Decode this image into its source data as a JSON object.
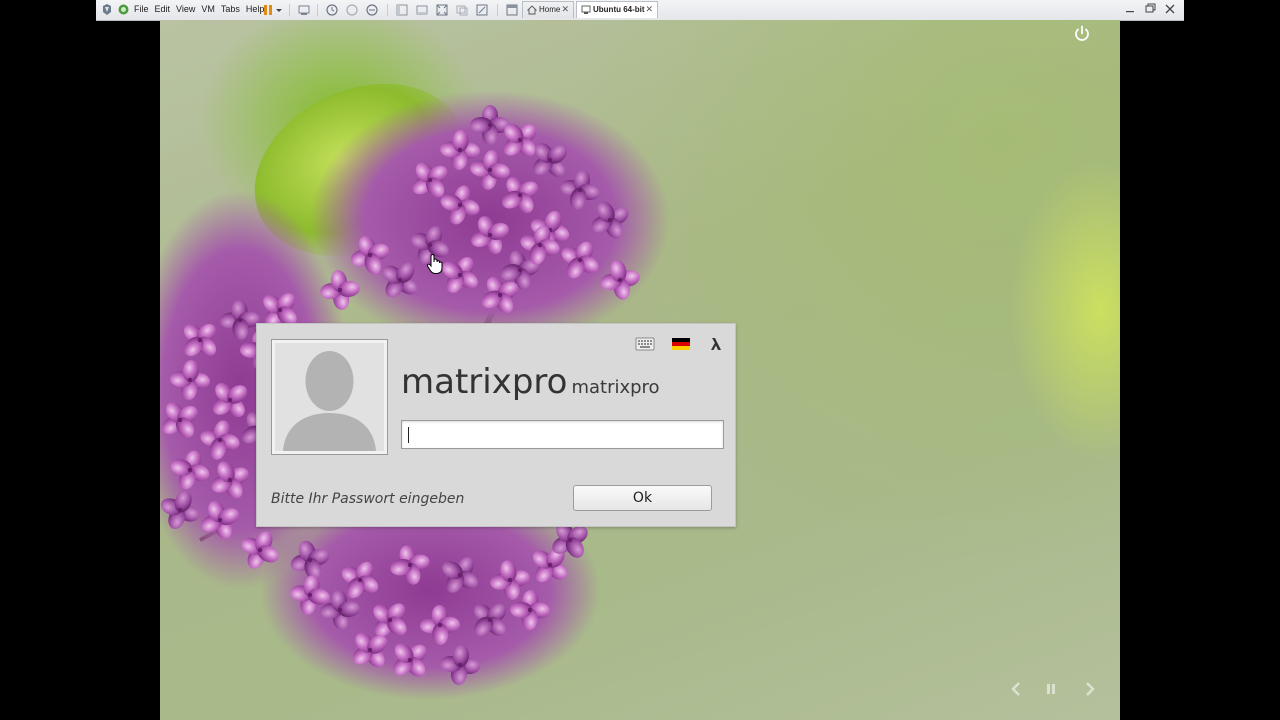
{
  "vmware": {
    "menu": [
      "File",
      "Edit",
      "View",
      "VM",
      "Tabs",
      "Help"
    ],
    "tabs": [
      {
        "label": "Home",
        "active": false
      },
      {
        "label": "Ubuntu 64-bit",
        "active": true
      }
    ],
    "tab_close_glyph": "✕",
    "toolbar_icons": [
      "pause-icon",
      "dropdown-arrow-icon",
      "send-ctrl-alt-del-icon",
      "snapshot-take-icon",
      "snapshot-revert-icon",
      "snapshot-manager-icon",
      "console-view-icon",
      "full-screen-icon",
      "fit-guest-icon",
      "unity-icon",
      "stretch-icon",
      "library-icon"
    ]
  },
  "login": {
    "username_large": "matrixpro",
    "username_small": "matrixpro",
    "password_value": "",
    "prompt": "Bitte Ihr Passwort eingeben",
    "ok_label": "Ok",
    "icons": [
      "keyboard-icon",
      "german-flag-icon",
      "lambda-session-icon"
    ]
  },
  "colors": {
    "dialog_bg": "#d9d9d9",
    "vm_bar_bg": "#eceef1",
    "flag": [
      "#000000",
      "#dd0000",
      "#ffce00"
    ]
  },
  "slideshow": {
    "icons": [
      "previous-arrow-icon",
      "pause-icon",
      "next-arrow-icon"
    ]
  }
}
